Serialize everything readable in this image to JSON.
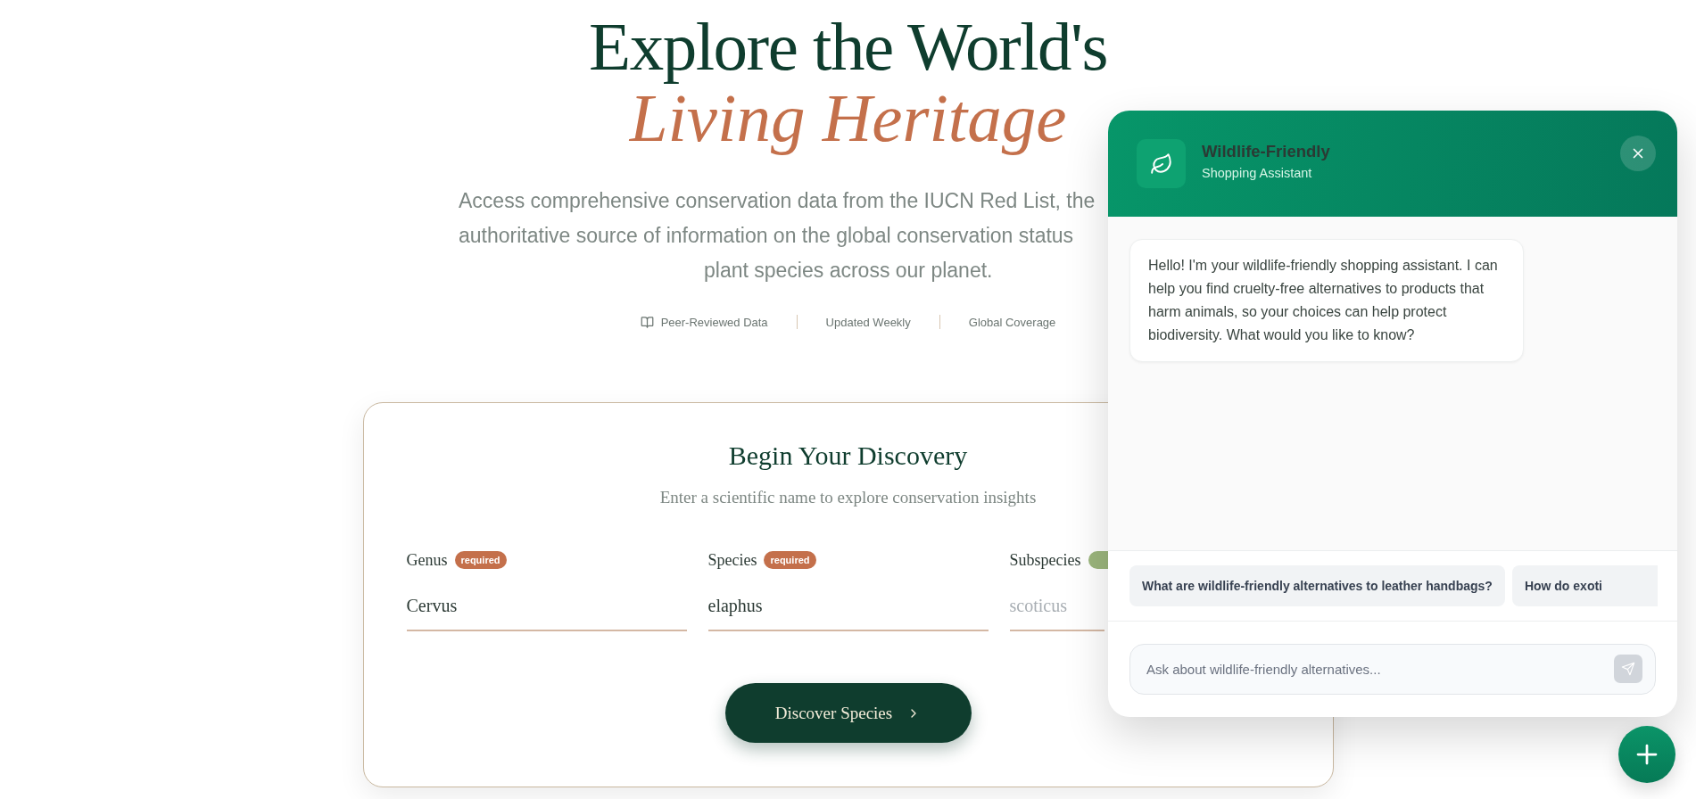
{
  "hero": {
    "title": "Explore the World's",
    "title_accent": "Living Heritage",
    "intro_lines": [
      "Access comprehensive conservation data from the IUCN Red List, the",
      "authoritative source of information on the global conservation status",
      "plant species across our planet."
    ],
    "facts": [
      {
        "label": "Peer-Reviewed Data",
        "icon": true
      },
      {
        "label": "Updated Weekly",
        "icon": false
      },
      {
        "label": "Global Coverage",
        "icon": false
      }
    ]
  },
  "search_card": {
    "title": "Begin Your Discovery",
    "subtitle": "Enter a scientific name to explore conservation insights",
    "fields": [
      {
        "label": "Genus",
        "badge": {
          "text": "required",
          "color": "#c4704b"
        },
        "value": "Cervus"
      },
      {
        "label": "Species",
        "badge": {
          "text": "required",
          "color": "#c4704b"
        },
        "value": "elaphus"
      },
      {
        "label": "Subspecies",
        "badge": {
          "color": "#9cb67d"
        },
        "placeholder": "scoticus"
      }
    ],
    "submit": "Discover Species"
  },
  "chat": {
    "title": "Wildlife-Friendly",
    "subtitle": "Shopping Assistant",
    "messages": [
      {
        "text": "Hello! I'm your wildlife-friendly shopping assistant. I can help you find cruelty-free alternatives to products that harm animals, so your choices can help protect biodiversity. What would you like to know?"
      }
    ],
    "suggestions": [
      "What are wildlife-friendly alternatives to leather handbags?",
      "How do exoti"
    ],
    "input": {
      "placeholder": "Ask about wildlife-friendly alternatives..."
    }
  }
}
